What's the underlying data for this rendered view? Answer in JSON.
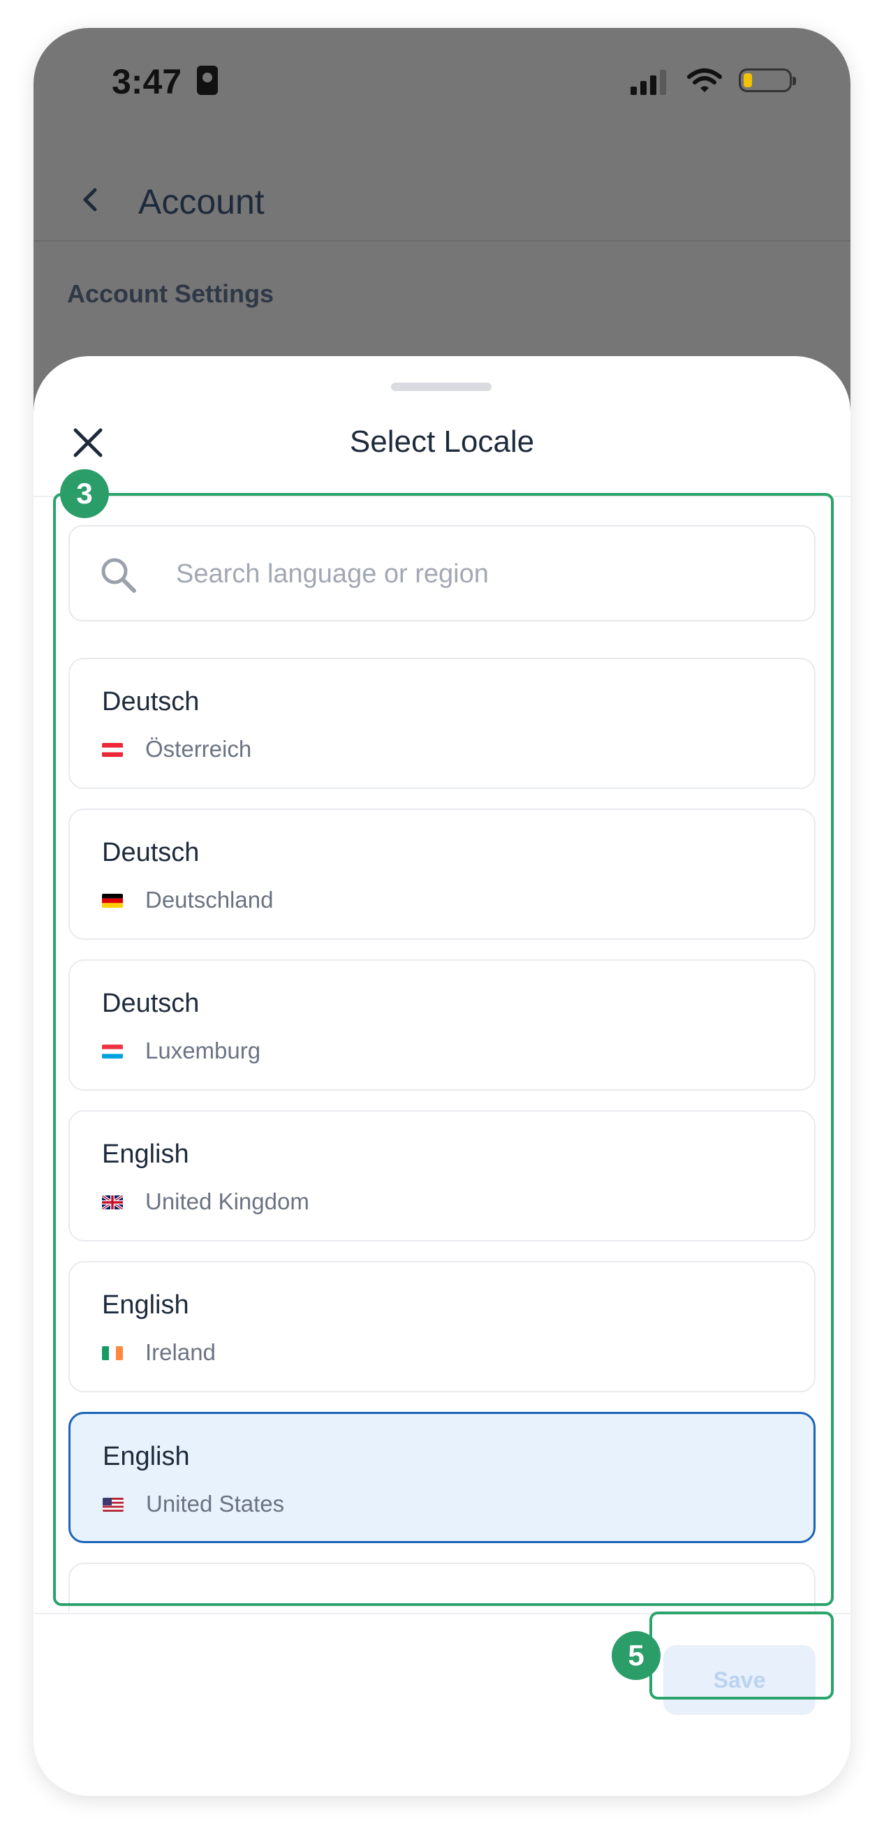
{
  "status_bar": {
    "time": "3:47"
  },
  "header": {
    "title": "Account"
  },
  "account": {
    "section_label": "Account Settings"
  },
  "sheet": {
    "title": "Select Locale",
    "search": {
      "placeholder": "Search language or region",
      "value": ""
    },
    "locales": [
      {
        "language": "Deutsch",
        "region": "Österreich",
        "flag": "flag-at-icon",
        "selected": false
      },
      {
        "language": "Deutsch",
        "region": "Deutschland",
        "flag": "flag-de-icon",
        "selected": false
      },
      {
        "language": "Deutsch",
        "region": "Luxemburg",
        "flag": "flag-lu-icon",
        "selected": false
      },
      {
        "language": "English",
        "region": "United Kingdom",
        "flag": "flag-gb-icon",
        "selected": false
      },
      {
        "language": "English",
        "region": "Ireland",
        "flag": "flag-ie-icon",
        "selected": false
      },
      {
        "language": "English",
        "region": "United States",
        "flag": "flag-us-icon",
        "selected": true
      }
    ],
    "save_label": "Save"
  },
  "annotations": [
    {
      "number": "3",
      "target": "locale-list"
    },
    {
      "number": "5",
      "target": "save-button"
    }
  ],
  "colors": {
    "accent": "#1a64b8",
    "selected_bg": "#e8f2fc",
    "annotation": "#2aa36d",
    "backdrop": "#767676"
  }
}
